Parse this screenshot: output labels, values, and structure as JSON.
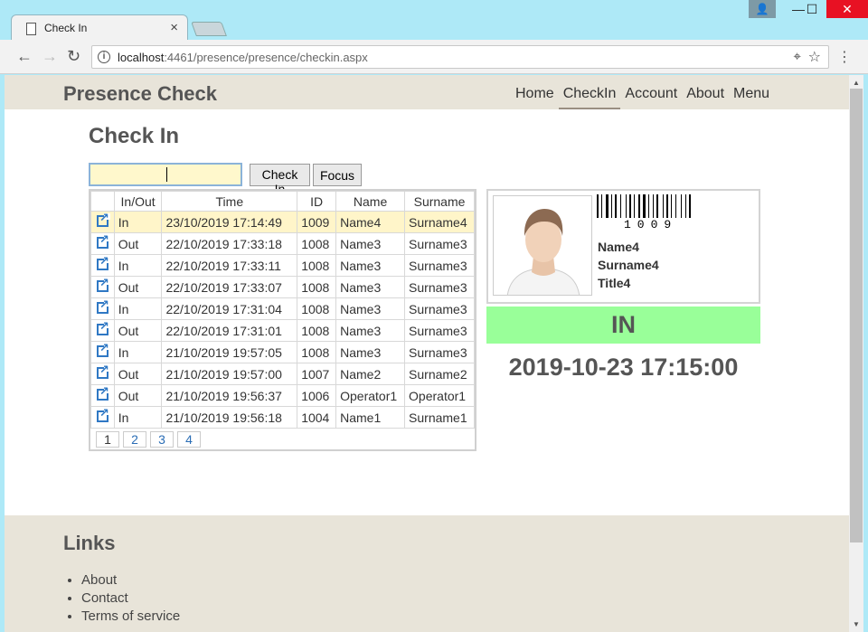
{
  "browser": {
    "tab_title": "Check In",
    "url_host": "localhost",
    "url_path": ":4461/presence/presence/checkin.aspx"
  },
  "site": {
    "brand": "Presence Check",
    "nav": [
      "Home",
      "CheckIn",
      "Account",
      "About",
      "Menu"
    ],
    "active_nav": "CheckIn"
  },
  "page": {
    "title": "Check In",
    "input_value": "",
    "checkin_label": "Check In",
    "focus_label": "Focus"
  },
  "table": {
    "columns": [
      "",
      "In/Out",
      "Time",
      "ID",
      "Name",
      "Surname"
    ],
    "rows": [
      [
        "In",
        "23/10/2019 17:14:49",
        "1009",
        "Name4",
        "Surname4"
      ],
      [
        "Out",
        "22/10/2019 17:33:18",
        "1008",
        "Name3",
        "Surname3"
      ],
      [
        "In",
        "22/10/2019 17:33:11",
        "1008",
        "Name3",
        "Surname3"
      ],
      [
        "Out",
        "22/10/2019 17:33:07",
        "1008",
        "Name3",
        "Surname3"
      ],
      [
        "In",
        "22/10/2019 17:31:04",
        "1008",
        "Name3",
        "Surname3"
      ],
      [
        "Out",
        "22/10/2019 17:31:01",
        "1008",
        "Name3",
        "Surname3"
      ],
      [
        "In",
        "21/10/2019 19:57:05",
        "1008",
        "Name3",
        "Surname3"
      ],
      [
        "Out",
        "21/10/2019 19:57:00",
        "1007",
        "Name2",
        "Surname2"
      ],
      [
        "Out",
        "21/10/2019 19:56:37",
        "1006",
        "Operator1",
        "Operator1"
      ],
      [
        "In",
        "21/10/2019 19:56:18",
        "1004",
        "Name1",
        "Surname1"
      ]
    ],
    "pages": [
      "1",
      "2",
      "3",
      "4"
    ],
    "current_page": "1"
  },
  "card": {
    "barcode": "1009",
    "name": "Name4",
    "surname": "Surname4",
    "title": "Title4"
  },
  "status": {
    "label": "IN",
    "color": "#99ff99",
    "timestamp": "2019-10-23 17:15:00"
  },
  "footer": {
    "heading": "Links",
    "links": [
      "About",
      "Contact",
      "Terms of service"
    ]
  }
}
